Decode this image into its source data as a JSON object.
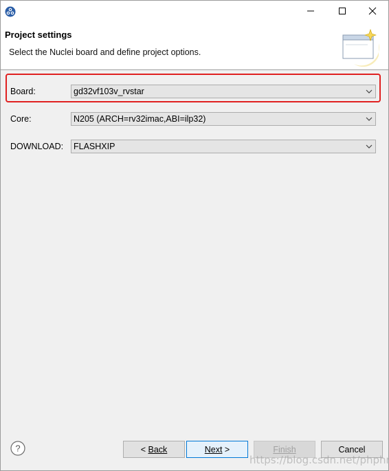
{
  "window": {
    "controls": {
      "minimize": "—",
      "maximize": "☐",
      "close": "✕"
    }
  },
  "header": {
    "title": "Project settings",
    "description": "Select the Nuclei board and define project options."
  },
  "fields": {
    "board": {
      "label": "Board:",
      "value": "gd32vf103v_rvstar"
    },
    "core": {
      "label": "Core:",
      "value": "N205 (ARCH=rv32imac,ABI=ilp32)"
    },
    "download": {
      "label": "DOWNLOAD:",
      "value": "FLASHXIP"
    }
  },
  "footer": {
    "help": "?",
    "back_prefix": "< ",
    "back_label": "Back",
    "next_label": "Next",
    "next_suffix": " >",
    "finish_label": "Finish",
    "cancel_label": "Cancel"
  },
  "watermark": "https://blog.csdn.net/phphro",
  "colors": {
    "highlight": "#e02020",
    "default_button_border": "#0078d7"
  }
}
